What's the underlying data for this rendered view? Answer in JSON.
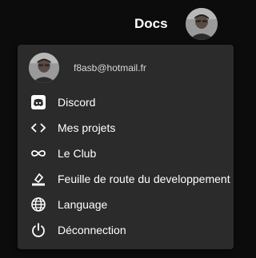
{
  "header": {
    "docs_label": "Docs",
    "avatar_icon": "user-avatar"
  },
  "user_menu": {
    "email": "f8asb@hotmail.fr",
    "items": [
      {
        "label": "Discord",
        "icon": "discord-icon"
      },
      {
        "label": "Mes projets",
        "icon": "code-icon"
      },
      {
        "label": "Le Club",
        "icon": "infinity-icon"
      },
      {
        "label": "Feuille de route du developpement",
        "icon": "roadmap-icon"
      },
      {
        "label": "Language",
        "icon": "globe-icon"
      },
      {
        "label": "Déconnection",
        "icon": "power-icon"
      }
    ]
  },
  "colors": {
    "page_background": "#0c0c0c",
    "menu_background": "#2b2b2b",
    "text": "#ffffff",
    "email_text": "#d8d8d8"
  }
}
